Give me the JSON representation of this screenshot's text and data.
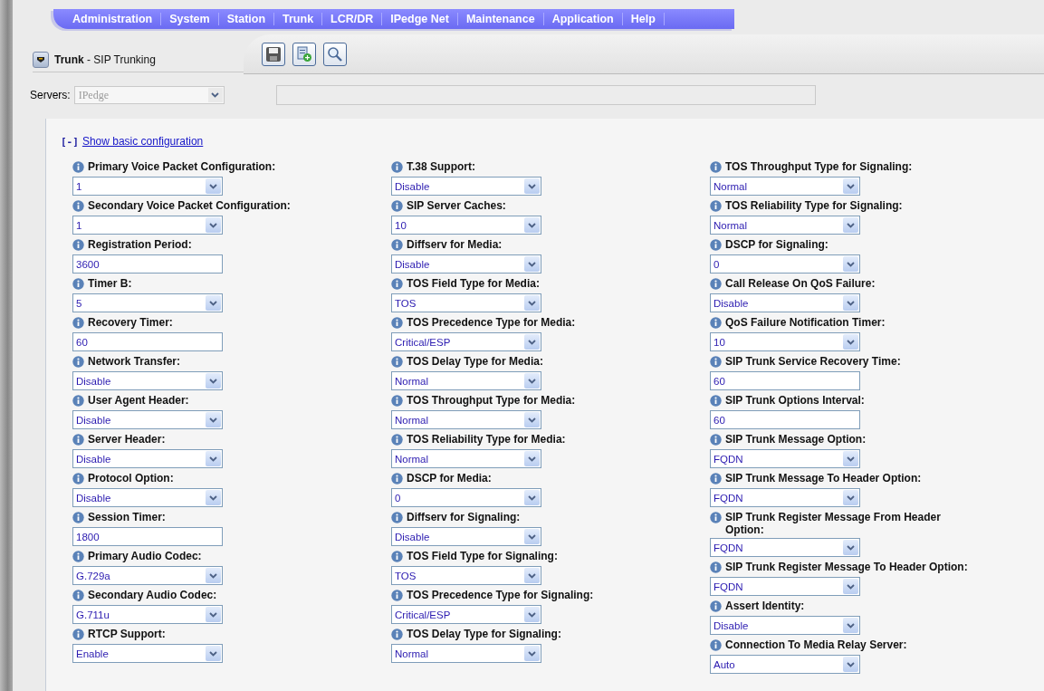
{
  "menu": [
    "Administration",
    "System",
    "Station",
    "Trunk",
    "LCR/DR",
    "IPedge Net",
    "Maintenance",
    "Application",
    "Help"
  ],
  "header": {
    "title": "Trunk",
    "subtitle": "- SIP Trunking"
  },
  "servers": {
    "label": "Servers:",
    "value": "IPedge",
    "disabled": true
  },
  "toggle": {
    "marker": "[-]",
    "link": "Show basic configuration"
  },
  "columns": [
    [
      {
        "label": "Primary Voice Packet Configuration:",
        "kind": "select",
        "value": "1"
      },
      {
        "label": "Secondary Voice Packet Configuration:",
        "kind": "select",
        "value": "1"
      },
      {
        "label": "Registration Period:",
        "kind": "text",
        "value": "3600"
      },
      {
        "label": "Timer B:",
        "kind": "select",
        "value": "5"
      },
      {
        "label": "Recovery Timer:",
        "kind": "text",
        "value": "60"
      },
      {
        "label": "Network Transfer:",
        "kind": "select",
        "value": "Disable"
      },
      {
        "label": "User Agent Header:",
        "kind": "select",
        "value": "Disable"
      },
      {
        "label": "Server Header:",
        "kind": "select",
        "value": "Disable"
      },
      {
        "label": "Protocol Option:",
        "kind": "select",
        "value": "Disable"
      },
      {
        "label": "Session Timer:",
        "kind": "text",
        "value": "1800"
      },
      {
        "label": "Primary Audio Codec:",
        "kind": "select",
        "value": "G.729a"
      },
      {
        "label": "Secondary Audio Codec:",
        "kind": "select",
        "value": "G.711u"
      },
      {
        "label": "RTCP Support:",
        "kind": "select",
        "value": "Enable"
      }
    ],
    [
      {
        "label": "T.38 Support:",
        "kind": "select",
        "value": "Disable"
      },
      {
        "label": "SIP Server Caches:",
        "kind": "select",
        "value": "10"
      },
      {
        "label": "Diffserv for Media:",
        "kind": "select",
        "value": "Disable"
      },
      {
        "label": "TOS Field Type for Media:",
        "kind": "select",
        "value": "TOS"
      },
      {
        "label": "TOS Precedence Type for Media:",
        "kind": "select",
        "value": "Critical/ESP"
      },
      {
        "label": "TOS Delay Type for Media:",
        "kind": "select",
        "value": "Normal"
      },
      {
        "label": "TOS Throughput Type for Media:",
        "kind": "select",
        "value": "Normal"
      },
      {
        "label": "TOS Reliability Type for Media:",
        "kind": "select",
        "value": "Normal"
      },
      {
        "label": "DSCP for Media:",
        "kind": "select",
        "value": "0"
      },
      {
        "label": "Diffserv for Signaling:",
        "kind": "select",
        "value": "Disable"
      },
      {
        "label": "TOS Field Type for Signaling:",
        "kind": "select",
        "value": "TOS"
      },
      {
        "label": "TOS Precedence Type for Signaling:",
        "kind": "select",
        "value": "Critical/ESP"
      },
      {
        "label": "TOS Delay Type for Signaling:",
        "kind": "select",
        "value": "Normal"
      }
    ],
    [
      {
        "label": "TOS Throughput Type for Signaling:",
        "kind": "select",
        "value": "Normal"
      },
      {
        "label": "TOS Reliability Type for Signaling:",
        "kind": "select",
        "value": "Normal"
      },
      {
        "label": "DSCP for Signaling:",
        "kind": "select",
        "value": "0"
      },
      {
        "label": "Call Release On QoS Failure:",
        "kind": "select",
        "value": "Disable"
      },
      {
        "label": "QoS Failure Notification Timer:",
        "kind": "select",
        "value": "10"
      },
      {
        "label": "SIP Trunk Service Recovery Time:",
        "kind": "text",
        "value": "60"
      },
      {
        "label": "SIP Trunk Options Interval:",
        "kind": "text",
        "value": "60"
      },
      {
        "label": "SIP Trunk Message Option:",
        "kind": "select",
        "value": "FQDN"
      },
      {
        "label": "SIP Trunk Message To Header Option:",
        "kind": "select",
        "value": "FQDN"
      },
      {
        "label": "SIP Trunk Register Message From Header Option:",
        "kind": "select",
        "value": "FQDN"
      },
      {
        "label": "SIP Trunk Register Message To Header Option:",
        "kind": "select",
        "value": "FQDN"
      },
      {
        "label": "Assert Identity:",
        "kind": "select",
        "value": "Disable"
      },
      {
        "label": "Connection To Media Relay Server:",
        "kind": "select",
        "value": "Auto"
      }
    ]
  ]
}
